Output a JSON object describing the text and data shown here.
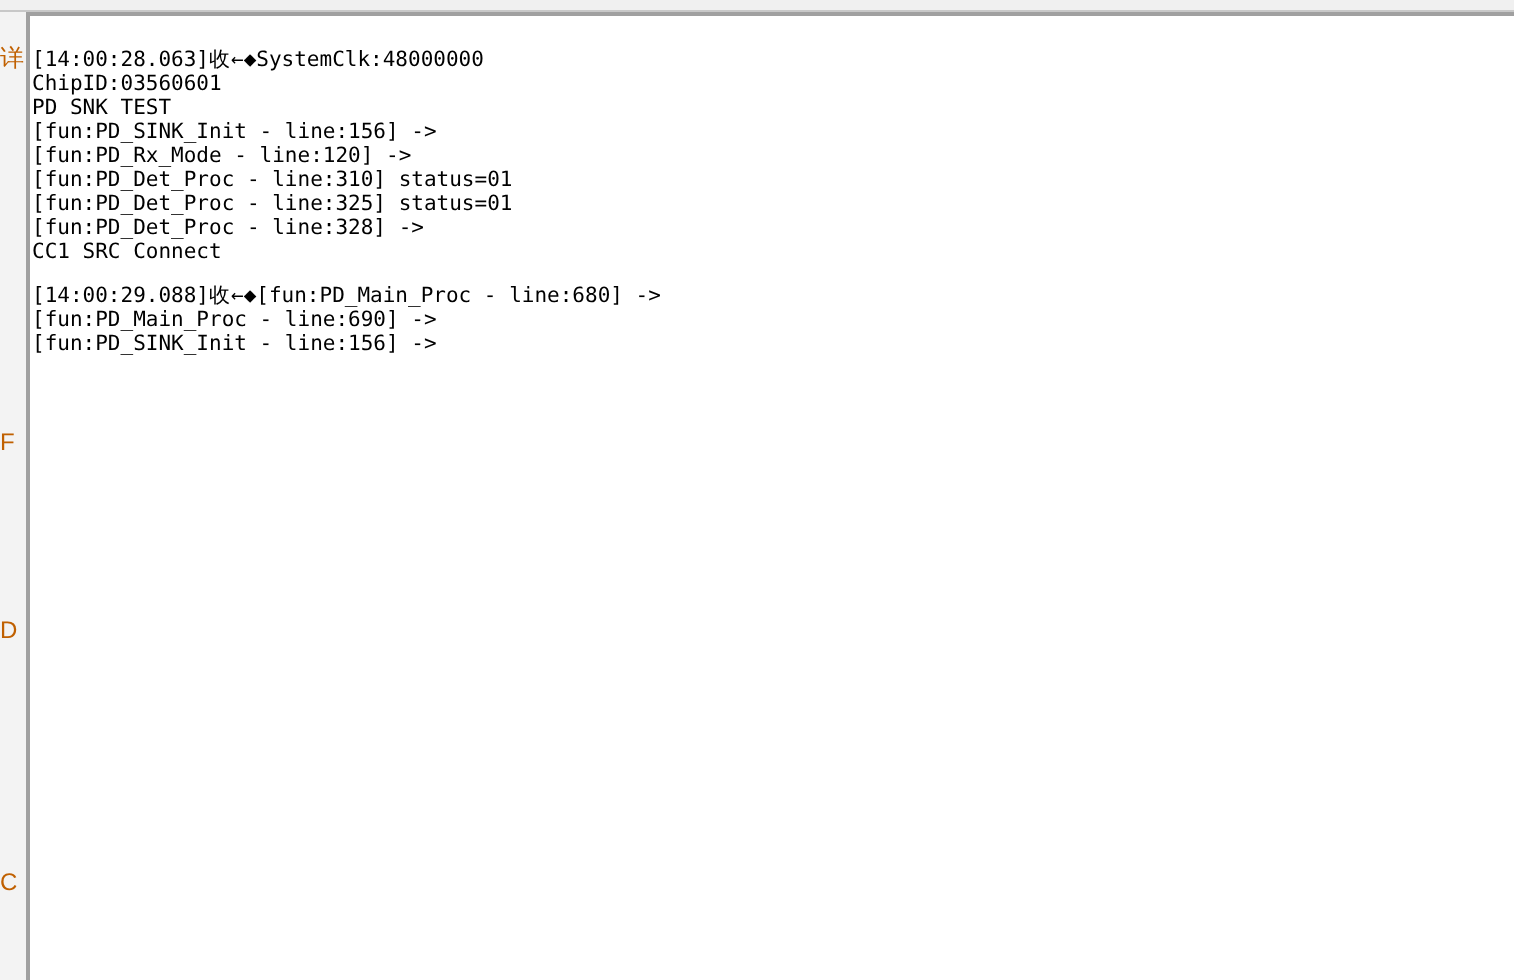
{
  "side_panel": {
    "fragments": [
      "详",
      "F",
      "D",
      "C"
    ]
  },
  "log": {
    "blocks": [
      {
        "lines": [
          "[14:00:28.063]收←◆SystemClk:48000000",
          "ChipID:03560601",
          "PD SNK TEST",
          "[fun:PD_SINK_Init - line:156] ->",
          "[fun:PD_Rx_Mode - line:120] ->",
          "[fun:PD_Det_Proc - line:310] status=01",
          "[fun:PD_Det_Proc - line:325] status=01",
          "[fun:PD_Det_Proc - line:328] ->",
          "CC1 SRC Connect"
        ]
      },
      {
        "lines": [
          "[14:00:29.088]收←◆[fun:PD_Main_Proc - line:680] ->",
          "[fun:PD_Main_Proc - line:690] ->",
          "[fun:PD_SINK_Init - line:156] ->"
        ]
      }
    ]
  }
}
